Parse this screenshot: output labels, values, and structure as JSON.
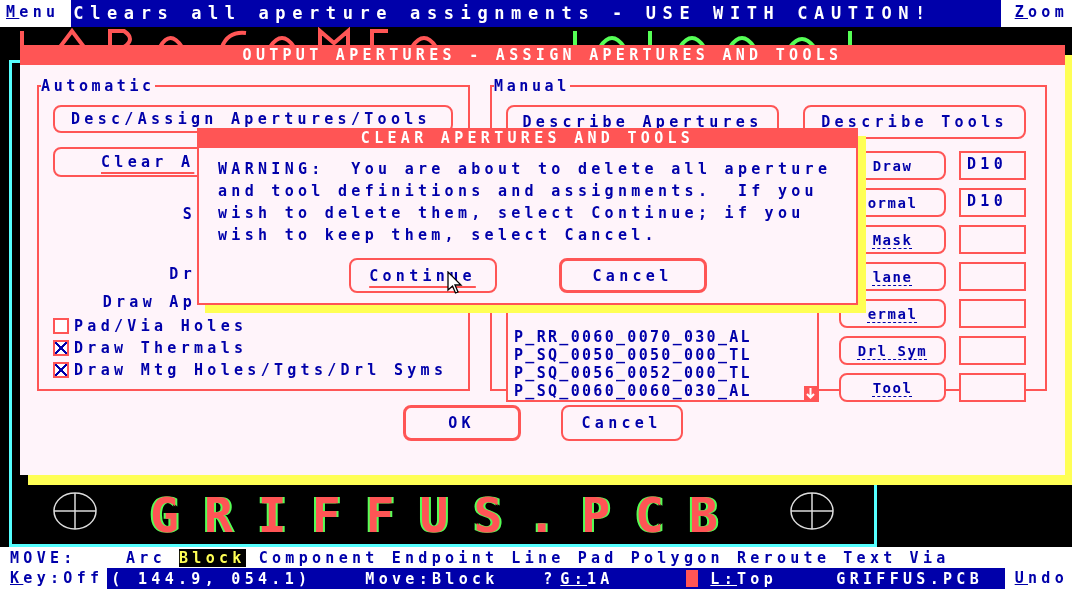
{
  "menu_bar": {
    "menu": "Menu",
    "message": "Clears all aperture assignments - USE WITH CAUTION!",
    "zoom": "Zoom"
  },
  "canvas": {
    "board_name": "GRIFFUS.PCB"
  },
  "output_dialog": {
    "title": "OUTPUT APERTURES - ASSIGN APERTURES AND TOOLS",
    "automatic": {
      "legend": "Automatic",
      "buttons": [
        {
          "label": "Desc/Assign Apertures/Tools",
          "focused": false
        },
        {
          "label": "Clear A",
          "focused": true
        }
      ],
      "labels": [
        "S",
        "Dr",
        "Draw Ap"
      ],
      "checkboxes": [
        {
          "label": "Pad/Via Holes",
          "checked": false
        },
        {
          "label": "Draw Thermals",
          "checked": true
        },
        {
          "label": "Draw Mtg Holes/Tgts/Drl Syms",
          "checked": true
        }
      ]
    },
    "manual": {
      "legend": "Manual",
      "describe_apertures": "Describe Apertures",
      "describe_tools": "Describe Tools",
      "aperture_list": [
        "P_RR_0060_0070_030_AL",
        "P_SQ_0050_0050_000_TL",
        "P_SQ_0056_0052_000_TL",
        "P_SQ_0060_0060_030_AL"
      ],
      "tools": [
        {
          "label": "Draw",
          "disabled": false,
          "value": "D10"
        },
        {
          "label": "ormal",
          "disabled": false,
          "value": "D10"
        },
        {
          "label": "Mask",
          "disabled": true
        },
        {
          "label": "lane",
          "disabled": true
        },
        {
          "label": "ermal",
          "disabled": true
        },
        {
          "label": "Drl Sym",
          "disabled": true
        },
        {
          "label": "Tool",
          "disabled": true
        }
      ]
    },
    "buttons": [
      {
        "label": "OK",
        "default": true
      },
      {
        "label": "Cancel",
        "default": false
      }
    ]
  },
  "clear_dialog": {
    "title": "CLEAR APERTURES AND TOOLS",
    "message": "WARNING:  You are about to delete all aperture\nand tool definitions and assignments.  If you\nwish to delete them, select Continue; if you\nwish to keep them, select Cancel.",
    "buttons": [
      {
        "label": "Continue",
        "default": false,
        "focused": true
      },
      {
        "label": "Cancel",
        "default": true,
        "focused": false
      }
    ]
  },
  "command_bar": {
    "label": "MOVE:",
    "items": [
      {
        "label": "Arc",
        "selected": false
      },
      {
        "label": "Block",
        "selected": true
      },
      {
        "label": "Component",
        "selected": false
      },
      {
        "label": "Endpoint",
        "selected": false
      },
      {
        "label": "Line",
        "selected": false
      },
      {
        "label": "Pad",
        "selected": false
      },
      {
        "label": "Polygon",
        "selected": false
      },
      {
        "label": "Reroute",
        "selected": false
      },
      {
        "label": "Text",
        "selected": false
      },
      {
        "label": "Via",
        "selected": false
      }
    ]
  },
  "status_bar": {
    "key": "Key:Off",
    "coordinates": "( 144.9, 054.1)",
    "mode": "Move:Block",
    "help": "?",
    "grid": "G:1A",
    "layer": "L:Top",
    "file": "GRIFFUS.PCB",
    "undo": "Undo"
  }
}
